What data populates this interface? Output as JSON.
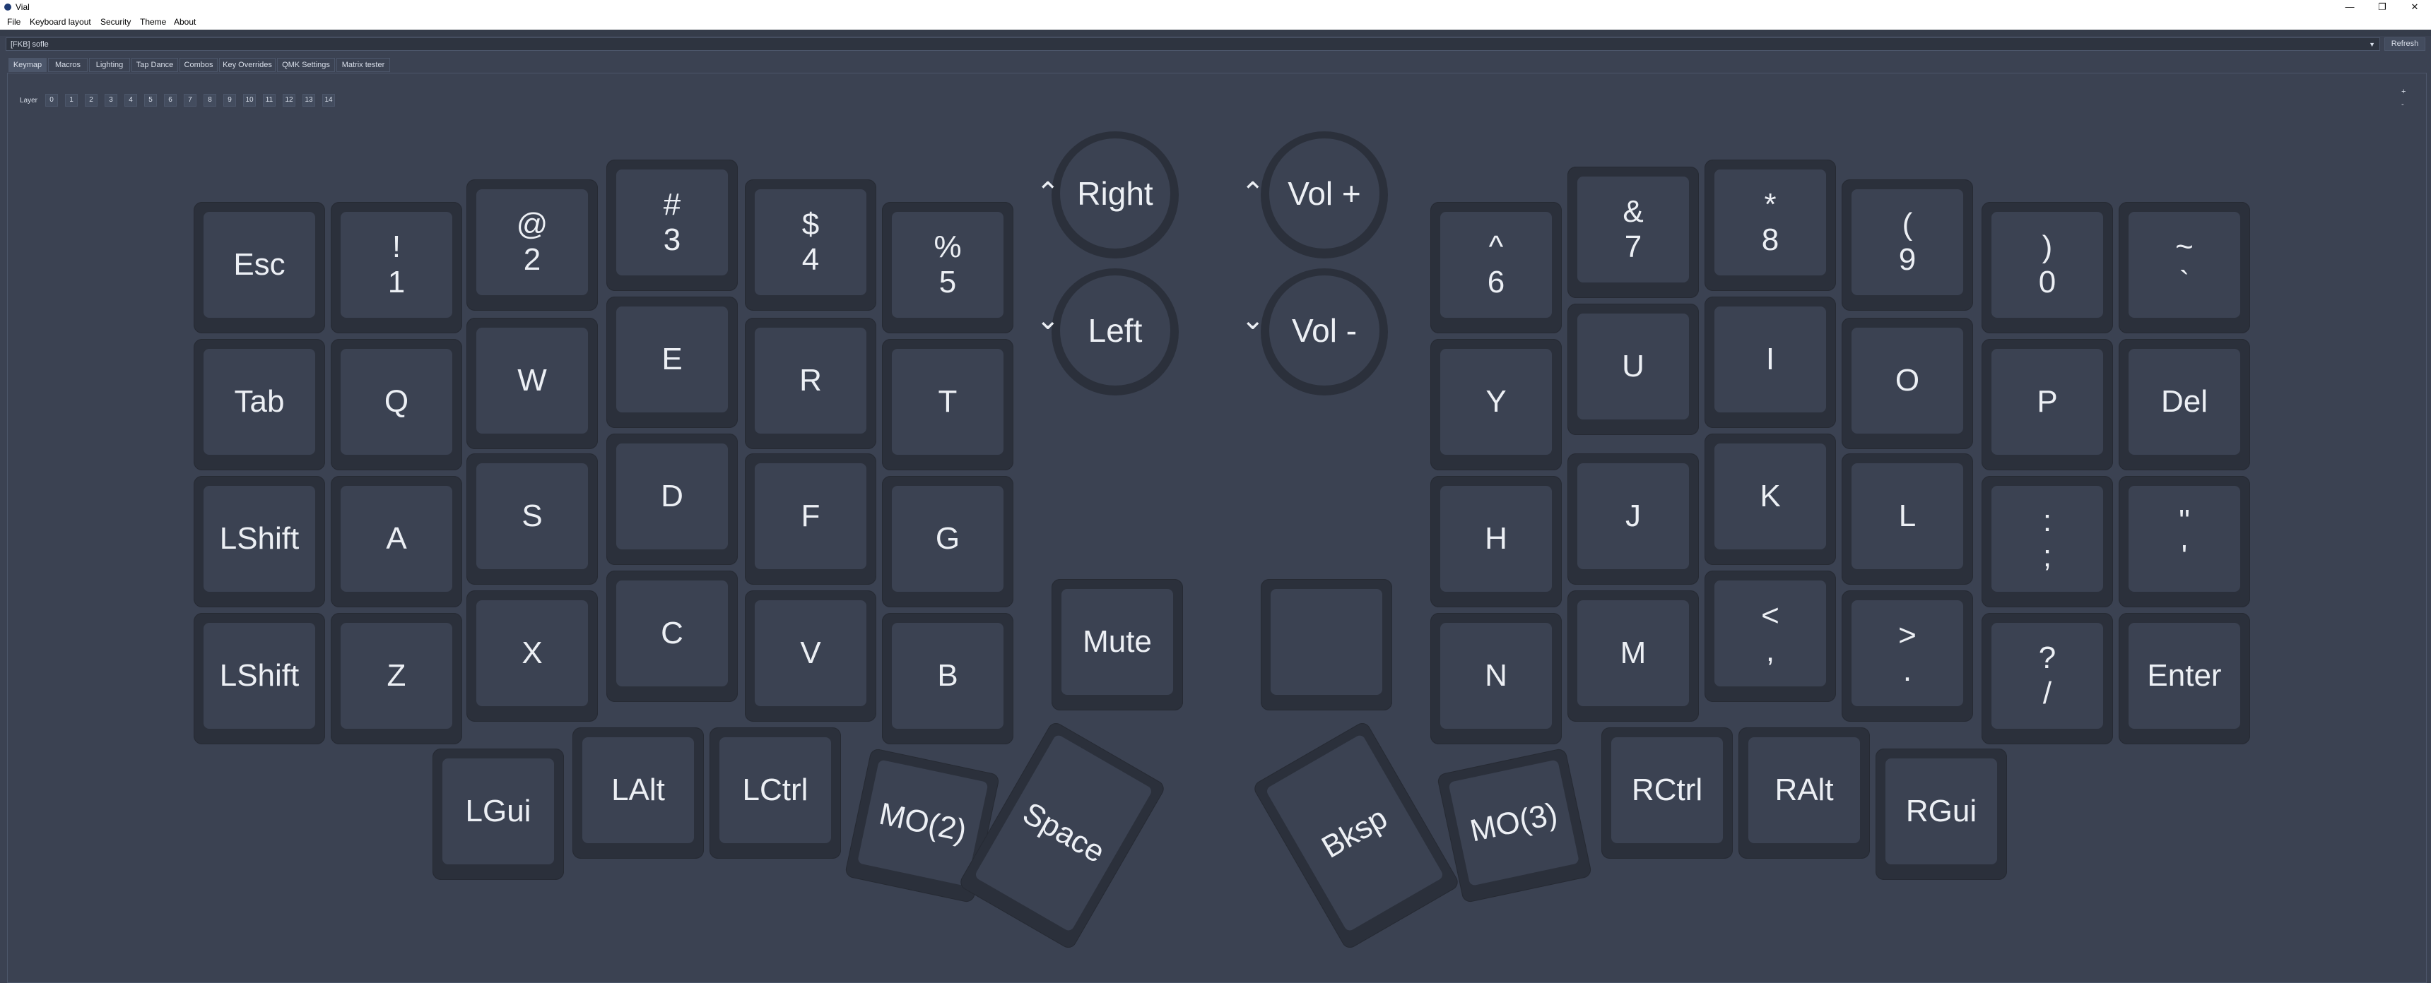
{
  "window": {
    "title": "Vial",
    "minimize": "—",
    "restore": "❐",
    "close": "✕"
  },
  "menu": [
    "File",
    "Keyboard layout",
    "Security",
    "Theme",
    "About"
  ],
  "device": {
    "selected": "[FKB] sofle",
    "refresh_label": "Refresh"
  },
  "tabs": [
    "Keymap",
    "Macros",
    "Lighting",
    "Tap Dance",
    "Combos",
    "Key Overrides",
    "QMK Settings",
    "Matrix tester"
  ],
  "layers": {
    "label": "Layer",
    "items": [
      "0",
      "1",
      "2",
      "3",
      "4",
      "5",
      "6",
      "7",
      "8",
      "9",
      "10",
      "11",
      "12",
      "13",
      "14"
    ]
  },
  "zoom": {
    "plus": "+",
    "minus": "-"
  },
  "keys": {
    "esc": [
      "Esc"
    ],
    "k1": [
      "!",
      "1"
    ],
    "k2": [
      "@",
      "2"
    ],
    "k3": [
      "#",
      "3"
    ],
    "k4": [
      "$",
      "4"
    ],
    "k5": [
      "%",
      "5"
    ],
    "tab": [
      "Tab"
    ],
    "q": [
      "Q"
    ],
    "w": [
      "W"
    ],
    "e": [
      "E"
    ],
    "r": [
      "R"
    ],
    "t": [
      "T"
    ],
    "lshift1": [
      "LShift"
    ],
    "a": [
      "A"
    ],
    "s": [
      "S"
    ],
    "d": [
      "D"
    ],
    "f": [
      "F"
    ],
    "g": [
      "G"
    ],
    "lshift2": [
      "LShift"
    ],
    "z": [
      "Z"
    ],
    "x": [
      "X"
    ],
    "c": [
      "C"
    ],
    "v": [
      "V"
    ],
    "b": [
      "B"
    ],
    "lgui": [
      "LGui"
    ],
    "lalt": [
      "LAlt"
    ],
    "lctrl": [
      "LCtrl"
    ],
    "mo2": [
      "MO(2)"
    ],
    "space": [
      "Space"
    ],
    "k6": [
      "^",
      "6"
    ],
    "k7": [
      "&",
      "7"
    ],
    "k8": [
      "*",
      "8"
    ],
    "k9": [
      "(",
      "9"
    ],
    "k0": [
      ")",
      "0"
    ],
    "tilde": [
      "~",
      "`"
    ],
    "y": [
      "Y"
    ],
    "u": [
      "U"
    ],
    "i": [
      "I"
    ],
    "o": [
      "O"
    ],
    "p": [
      "P"
    ],
    "del": [
      "Del"
    ],
    "h": [
      "H"
    ],
    "j": [
      "J"
    ],
    "k": [
      "K"
    ],
    "l": [
      "L"
    ],
    "semi": [
      ":",
      ";"
    ],
    "quote": [
      "\"",
      "'"
    ],
    "n": [
      "N"
    ],
    "m": [
      "M"
    ],
    "comma": [
      "<",
      ","
    ],
    "dot": [
      ">",
      "."
    ],
    "slash": [
      "?",
      "/"
    ],
    "enter": [
      "Enter"
    ],
    "bksp": [
      "Bksp"
    ],
    "mo3": [
      "MO(3)"
    ],
    "rctrl": [
      "RCtrl"
    ],
    "ralt": [
      "RAlt"
    ],
    "rgui": [
      "RGui"
    ],
    "mute": [
      "Mute"
    ],
    "blank": []
  },
  "encoders": {
    "left_cw": "Right",
    "left_ccw": "Left",
    "right_cw": "Vol +",
    "right_ccw": "Vol -",
    "up_arrow": "⌃",
    "down_arrow": "⌄"
  }
}
